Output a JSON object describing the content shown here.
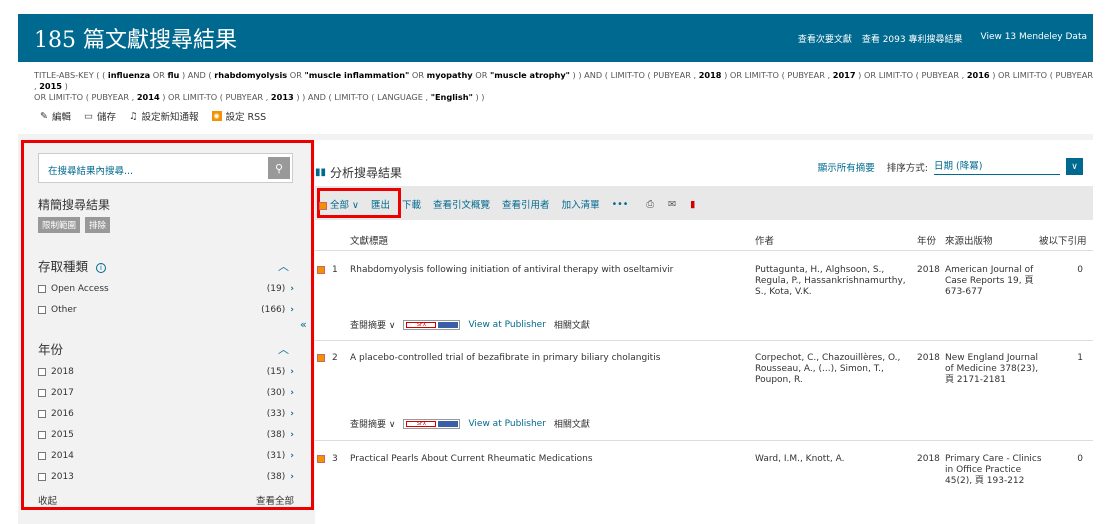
{
  "header": {
    "title": "185 篇文獻搜尋結果",
    "links": [
      "查看次要文獻",
      "查看 2093 專利搜尋結果",
      "View 13 Mendeley Data"
    ]
  },
  "query": {
    "line1_parts": [
      {
        "t": "TITLE-ABS-KEY ( ( ",
        "hl": false
      },
      {
        "t": "influenza",
        "hl": true
      },
      {
        "t": " OR ",
        "hl": false
      },
      {
        "t": "flu",
        "hl": true
      },
      {
        "t": " ) AND ( ",
        "hl": false
      },
      {
        "t": "rhabdomyolysis",
        "hl": true
      },
      {
        "t": " OR ",
        "hl": false
      },
      {
        "t": "\"muscle inflammation\"",
        "hl": true
      },
      {
        "t": " OR ",
        "hl": false
      },
      {
        "t": "myopathy",
        "hl": true
      },
      {
        "t": " OR ",
        "hl": false
      },
      {
        "t": "\"muscle atrophy\"",
        "hl": true
      },
      {
        "t": " ) ) AND ( LIMIT-TO ( PUBYEAR , ",
        "hl": false
      },
      {
        "t": "2018",
        "hl": true
      },
      {
        "t": " ) OR LIMIT-TO ( PUBYEAR , ",
        "hl": false
      },
      {
        "t": "2017",
        "hl": true
      },
      {
        "t": " ) OR LIMIT-TO ( PUBYEAR , ",
        "hl": false
      },
      {
        "t": "2016",
        "hl": true
      },
      {
        "t": " ) OR LIMIT-TO ( PUBYEAR , ",
        "hl": false
      },
      {
        "t": "2015",
        "hl": true
      },
      {
        "t": " )",
        "hl": false
      }
    ],
    "line2_parts": [
      {
        "t": "OR LIMIT-TO ( PUBYEAR , ",
        "hl": false
      },
      {
        "t": "2014",
        "hl": true
      },
      {
        "t": " ) OR LIMIT-TO ( PUBYEAR , ",
        "hl": false
      },
      {
        "t": "2013",
        "hl": true
      },
      {
        "t": " ) ) AND ( LIMIT-TO ( LANGUAGE , ",
        "hl": false
      },
      {
        "t": "\"English\"",
        "hl": true
      },
      {
        "t": " ) )",
        "hl": false
      }
    ]
  },
  "actions": {
    "edit": "編輯",
    "save": "儲存",
    "alert": "設定新知通報",
    "rss": "設定 RSS"
  },
  "sidebar": {
    "search_placeholder": "在搜尋結果內搜尋...",
    "refine_title": "精簡搜尋結果",
    "limit_btn": "限制範圍",
    "exclude_btn": "排除",
    "access_title": "存取種類",
    "access_items": [
      {
        "label": "Open Access",
        "count": "(19)"
      },
      {
        "label": "Other",
        "count": "(166)"
      }
    ],
    "year_title": "年份",
    "year_items": [
      {
        "label": "2018",
        "count": "(15)"
      },
      {
        "label": "2017",
        "count": "(30)"
      },
      {
        "label": "2016",
        "count": "(33)"
      },
      {
        "label": "2015",
        "count": "(38)"
      },
      {
        "label": "2014",
        "count": "(31)"
      },
      {
        "label": "2013",
        "count": "(38)"
      }
    ],
    "collapse": "收起",
    "view_all": "查看全部"
  },
  "main": {
    "analyze": "分析搜尋結果",
    "show_abstracts": "顯示所有摘要",
    "sort_label": "排序方式:",
    "sort_value": "日期 (降冪)",
    "toolbar": {
      "all": "全部",
      "export": "匯出",
      "download": "下載",
      "citation_overview": "查看引文概覽",
      "cited_by": "查看引用者",
      "add_list": "加入清單",
      "more": "•••"
    },
    "columns": {
      "title": "文獻標題",
      "authors": "作者",
      "year": "年份",
      "source": "來源出版物",
      "cited": "被以下引用"
    },
    "results": [
      {
        "num": "1",
        "title": "Rhabdomyolysis following initiation of antiviral therapy with oseltamivir",
        "authors": "Puttagunta, H., Alghsoon, S., Regula, P., Hassankrishnamurthy, S., Kota, V.K.",
        "year": "2018",
        "source": "American Journal of Case Reports 19, 頁 673-677",
        "cited": "0"
      },
      {
        "num": "2",
        "title": "A placebo-controlled trial of bezafibrate in primary biliary cholangitis",
        "authors": "Corpechot, C., Chazouillères, O., Rousseau, A., (...), Simon, T., Poupon, R.",
        "year": "2018",
        "source": "New England Journal of Medicine 378(23), 頁 2171-2181",
        "cited": "1"
      },
      {
        "num": "3",
        "title": "Practical Pearls About Current Rheumatic Medications",
        "authors": "Ward, I.M., Knott, A.",
        "year": "2018",
        "source": "Primary Care - Clinics in Office Practice 45(2), 頁 193-212",
        "cited": "0"
      }
    ],
    "result_actions": {
      "abstract": "查閱摘要",
      "sfx": "SFX",
      "publisher": "View at Publisher",
      "related": "相關文獻"
    }
  }
}
